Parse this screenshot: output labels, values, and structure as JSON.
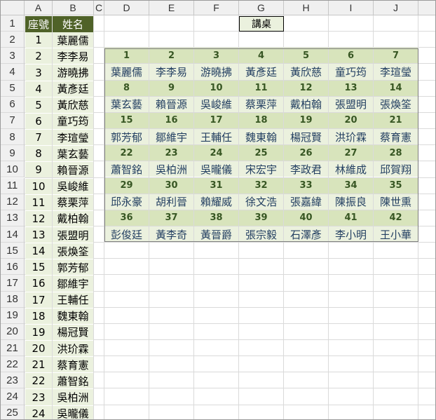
{
  "columns": [
    "A",
    "B",
    "C",
    "D",
    "E",
    "F",
    "G",
    "H",
    "I",
    "J"
  ],
  "rows": [
    "1",
    "2",
    "3",
    "4",
    "5",
    "6",
    "7",
    "8",
    "9",
    "10",
    "11",
    "12",
    "13",
    "14",
    "15",
    "16",
    "17",
    "18",
    "19",
    "20",
    "21",
    "22",
    "23",
    "24",
    "25"
  ],
  "roster": {
    "header_seat": "座號",
    "header_name": "姓名",
    "entries": [
      {
        "seat": "1",
        "name": "葉麗儒"
      },
      {
        "seat": "2",
        "name": "李李易"
      },
      {
        "seat": "3",
        "name": "游曉拂"
      },
      {
        "seat": "4",
        "name": "黃彥廷"
      },
      {
        "seat": "5",
        "name": "黃欣慈"
      },
      {
        "seat": "6",
        "name": "童巧筠"
      },
      {
        "seat": "7",
        "name": "李瑄瑩"
      },
      {
        "seat": "8",
        "name": "葉玄藝"
      },
      {
        "seat": "9",
        "name": "賴晉源"
      },
      {
        "seat": "10",
        "name": "吳峻維"
      },
      {
        "seat": "11",
        "name": "蔡栗萍"
      },
      {
        "seat": "12",
        "name": "戴柏翰"
      },
      {
        "seat": "13",
        "name": "張盟明"
      },
      {
        "seat": "14",
        "name": "張煥筌"
      },
      {
        "seat": "15",
        "name": "郭芳郁"
      },
      {
        "seat": "16",
        "name": "鄒維宇"
      },
      {
        "seat": "17",
        "name": "王輔任"
      },
      {
        "seat": "18",
        "name": "魏東翰"
      },
      {
        "seat": "19",
        "name": "楊冠賢"
      },
      {
        "seat": "20",
        "name": "洪玠霖"
      },
      {
        "seat": "21",
        "name": "蔡育憲"
      },
      {
        "seat": "22",
        "name": "蕭智銘"
      },
      {
        "seat": "23",
        "name": "吳柏洲"
      },
      {
        "seat": "24",
        "name": "吳曨儀"
      }
    ]
  },
  "desk_label": "講桌",
  "seating_chart": [
    [
      {
        "seat": "1",
        "name": "葉麗儒"
      },
      {
        "seat": "2",
        "name": "李李易"
      },
      {
        "seat": "3",
        "name": "游曉拂"
      },
      {
        "seat": "4",
        "name": "黃彥廷"
      },
      {
        "seat": "5",
        "name": "黃欣慈"
      },
      {
        "seat": "6",
        "name": "童巧筠"
      },
      {
        "seat": "7",
        "name": "李瑄瑩"
      }
    ],
    [
      {
        "seat": "8",
        "name": "葉玄藝"
      },
      {
        "seat": "9",
        "name": "賴晉源"
      },
      {
        "seat": "10",
        "name": "吳峻維"
      },
      {
        "seat": "11",
        "name": "蔡栗萍"
      },
      {
        "seat": "12",
        "name": "戴柏翰"
      },
      {
        "seat": "13",
        "name": "張盟明"
      },
      {
        "seat": "14",
        "name": "張煥筌"
      }
    ],
    [
      {
        "seat": "15",
        "name": "郭芳郁"
      },
      {
        "seat": "16",
        "name": "鄒維宇"
      },
      {
        "seat": "17",
        "name": "王輔任"
      },
      {
        "seat": "18",
        "name": "魏東翰"
      },
      {
        "seat": "19",
        "name": "楊冠賢"
      },
      {
        "seat": "20",
        "name": "洪玠霖"
      },
      {
        "seat": "21",
        "name": "蔡育憲"
      }
    ],
    [
      {
        "seat": "22",
        "name": "蕭智銘"
      },
      {
        "seat": "23",
        "name": "吳柏洲"
      },
      {
        "seat": "24",
        "name": "吳曨儀"
      },
      {
        "seat": "25",
        "name": "宋宏宇"
      },
      {
        "seat": "26",
        "name": "李政君"
      },
      {
        "seat": "27",
        "name": "林維成"
      },
      {
        "seat": "28",
        "name": "邱賀翔"
      }
    ],
    [
      {
        "seat": "29",
        "name": "邱永豪"
      },
      {
        "seat": "30",
        "name": "胡利晉"
      },
      {
        "seat": "31",
        "name": "賴耀威"
      },
      {
        "seat": "32",
        "name": "徐文浩"
      },
      {
        "seat": "33",
        "name": "張嘉緯"
      },
      {
        "seat": "34",
        "name": "陳振良"
      },
      {
        "seat": "35",
        "name": "陳世熏"
      }
    ],
    [
      {
        "seat": "36",
        "name": "彭俊廷"
      },
      {
        "seat": "37",
        "name": "黃李奇"
      },
      {
        "seat": "38",
        "name": "黃晉爵"
      },
      {
        "seat": "39",
        "name": "張宗毅"
      },
      {
        "seat": "40",
        "name": "石澤彥"
      },
      {
        "seat": "41",
        "name": "李小明"
      },
      {
        "seat": "42",
        "name": "王小華"
      }
    ]
  ],
  "colors": {
    "header_fill": "#4f6228",
    "header_text": "#ffffff",
    "cell_fill": "#ebf1de",
    "seat_number_fill": "#d8e4bc",
    "seat_number_text": "#375623",
    "seat_name_text": "#244062"
  }
}
